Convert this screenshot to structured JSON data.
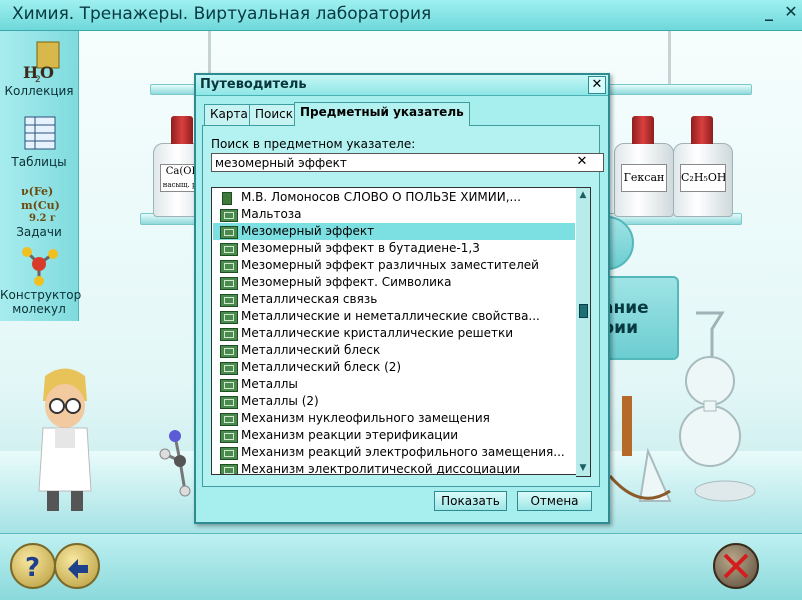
{
  "app": {
    "title": "Химия. Тренажеры. Виртуальная лаборатория",
    "minimize": "_",
    "close": "✕"
  },
  "sidebar": {
    "items": [
      {
        "label": "Коллекция",
        "icon": "h2o-collection-icon"
      },
      {
        "label": "Таблицы",
        "icon": "tables-icon"
      },
      {
        "label": "Задачи",
        "icon": "formula-tasks-icon"
      },
      {
        "label": "Конструктор\nмолекул",
        "icon": "molecule-constructor-icon"
      }
    ]
  },
  "background": {
    "bottle_labels": [
      "Ca(OH",
      "Гексан",
      "C₂H₅OH"
    ],
    "bottle_label_small": "насыщ. р-р",
    "panel_text_1": "ание",
    "panel_text_2": "рии"
  },
  "dialog": {
    "title": "Путеводитель",
    "close": "✕",
    "tabs": [
      {
        "label": "Карта",
        "active": false
      },
      {
        "label": "Поиск",
        "active": false
      },
      {
        "label": "Предметный указатель",
        "active": true
      }
    ],
    "search_label": "Поиск в предметном указателе:",
    "search_value": "мезомерный эффект",
    "search_clear": "✕",
    "list": [
      {
        "text": "М.В. Ломоносов СЛОВО О ПОЛЬЗЕ ХИМИИ,...",
        "icon": "book-icon",
        "selected": false
      },
      {
        "text": "Мальтоза",
        "icon": "media-icon",
        "selected": false
      },
      {
        "text": "Мезомерный эффект",
        "icon": "media-icon",
        "selected": true
      },
      {
        "text": "Мезомерный эффект в бутадиене-1,3",
        "icon": "media-icon",
        "selected": false
      },
      {
        "text": "Мезомерный эффект различных заместителей",
        "icon": "media-icon",
        "selected": false
      },
      {
        "text": "Мезомерный эффект. Символика",
        "icon": "media-icon",
        "selected": false
      },
      {
        "text": "Металлическая связь",
        "icon": "media-icon",
        "selected": false
      },
      {
        "text": "Металлические и неметаллические свойства...",
        "icon": "media-icon",
        "selected": false
      },
      {
        "text": "Металлические кристаллические решетки",
        "icon": "media-icon",
        "selected": false
      },
      {
        "text": "Металлический блеск",
        "icon": "media-icon",
        "selected": false
      },
      {
        "text": "Металлический блеск (2)",
        "icon": "media-icon",
        "selected": false
      },
      {
        "text": "Металлы",
        "icon": "media-icon",
        "selected": false
      },
      {
        "text": "Металлы (2)",
        "icon": "media-icon",
        "selected": false
      },
      {
        "text": "Механизм нуклеофильного замещения",
        "icon": "media-icon",
        "selected": false
      },
      {
        "text": "Механизм реакции этерификации",
        "icon": "media-icon",
        "selected": false
      },
      {
        "text": "Механизм реакций электрофильного замещения...",
        "icon": "media-icon",
        "selected": false
      },
      {
        "text": "Механизм электролитической диссоциации",
        "icon": "media-icon",
        "selected": false
      }
    ],
    "scroll_up": "▲",
    "scroll_down": "▼",
    "buttons": {
      "show": "Показать",
      "cancel": "Отмена"
    }
  },
  "bottombar": {
    "help_icon": "question-mark-icon",
    "exit_icon": "exit-arrow-icon",
    "tools_off_icon": "crossed-tools-icon"
  },
  "colors": {
    "accent": "#7fdbdd",
    "dialog_bg": "#a6efee",
    "selection": "#7ce0e2",
    "border": "#2e8b8f"
  }
}
